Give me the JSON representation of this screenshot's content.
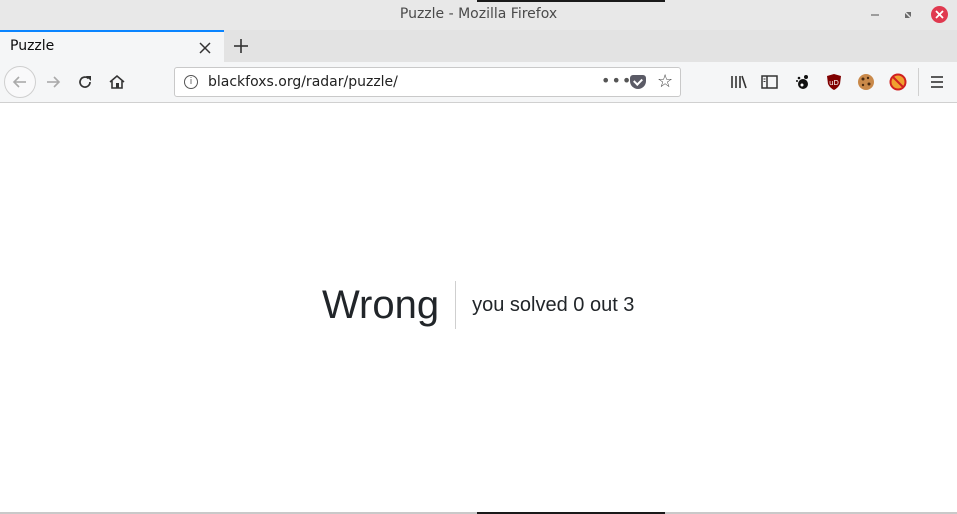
{
  "window": {
    "title": "Puzzle - Mozilla Firefox",
    "minimize_icon": "minimize-icon",
    "maximize_icon": "restore-icon",
    "close_icon": "close-icon"
  },
  "tabs": [
    {
      "label": "Puzzle",
      "active": true
    }
  ],
  "navbar": {
    "url": "blackfoxs.org/radar/puzzle/",
    "icons": [
      "back-icon",
      "forward-icon",
      "reload-icon",
      "home-icon",
      "info-icon",
      "page-actions-icon",
      "pocket-icon",
      "bookmark-star-icon",
      "library-icon",
      "sidebar-icon",
      "gnome-icon",
      "ublock-icon",
      "cookie-icon",
      "noscript-icon",
      "hamburger-menu-icon"
    ]
  },
  "page": {
    "headline": "Wrong",
    "detail": "you solved 0 out 3"
  },
  "colors": {
    "accent": "#0a84ff",
    "close_button": "#e0394f",
    "text": "#212529"
  }
}
